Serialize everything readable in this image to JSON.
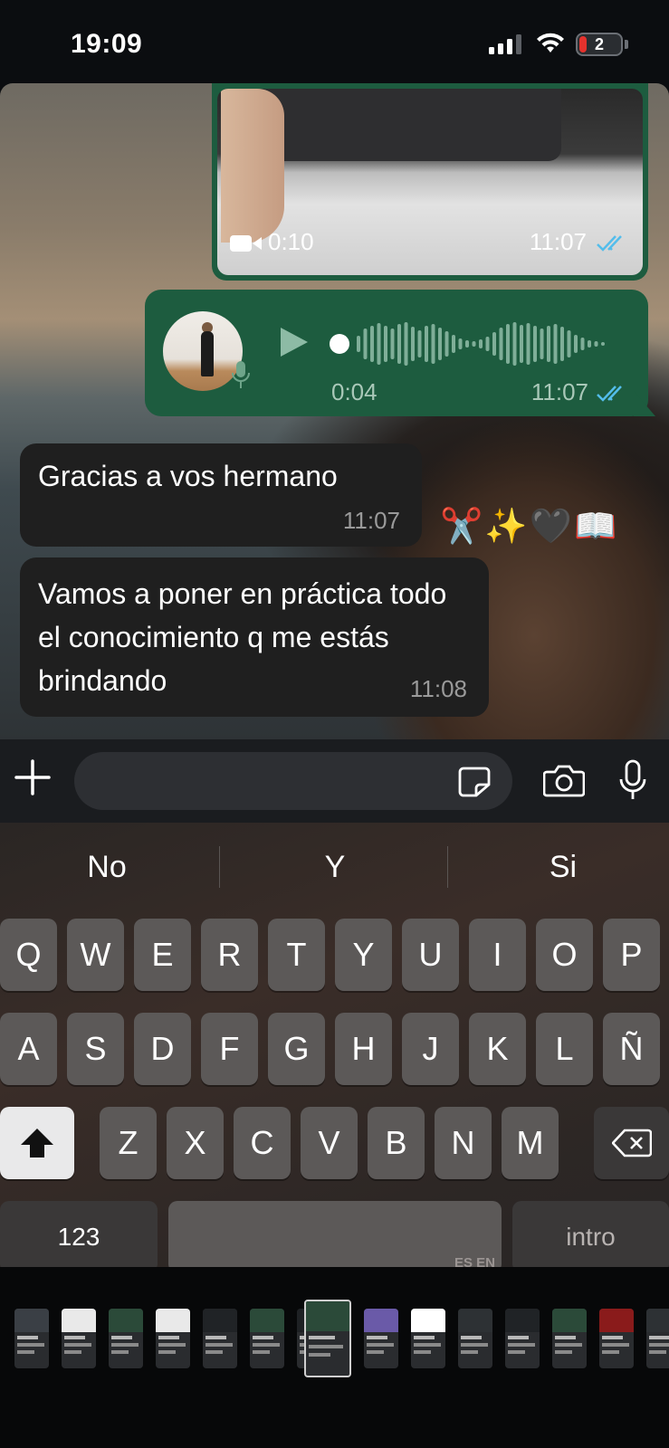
{
  "status_bar": {
    "time": "19:09",
    "battery": "2"
  },
  "chat": {
    "video": {
      "duration": "0:10",
      "time": "11:07"
    },
    "voice": {
      "duration": "0:04",
      "time": "11:07"
    },
    "messages": [
      {
        "text": "Gracias a vos hermano",
        "time": "11:07"
      },
      {
        "text": "Vamos a poner en práctica todo el conocimiento q me estás brindando",
        "time": "11:08"
      }
    ],
    "emoji_caption": "✂️✨🖤📖"
  },
  "input": {
    "placeholder": ""
  },
  "keyboard": {
    "suggestions": [
      "No",
      "Y",
      "Si"
    ],
    "row1": [
      "Q",
      "W",
      "E",
      "R",
      "T",
      "Y",
      "U",
      "I",
      "O",
      "P"
    ],
    "row2": [
      "A",
      "S",
      "D",
      "F",
      "G",
      "H",
      "J",
      "K",
      "L",
      "Ñ"
    ],
    "row3": [
      "Z",
      "X",
      "C",
      "V",
      "B",
      "N",
      "M"
    ],
    "numbers_key": "123",
    "return_key": "intro",
    "language_label": "ES EN"
  },
  "colors": {
    "outgoing_bubble": "#1d5c3f",
    "incoming_bubble": "#1f1f1f",
    "read_ticks": "#53bdeb"
  }
}
